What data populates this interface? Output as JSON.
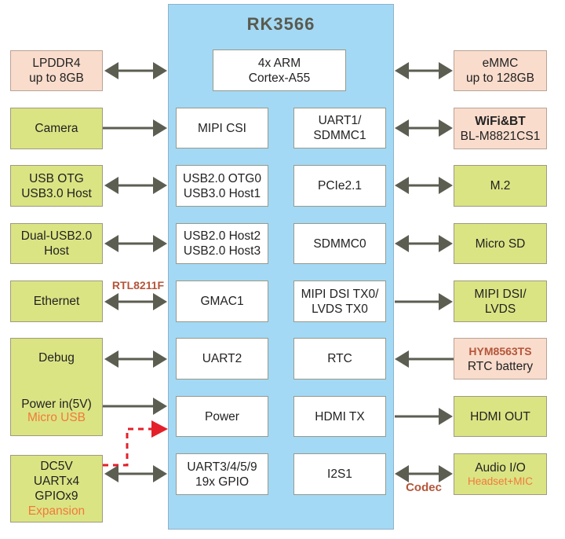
{
  "title": "RK3566",
  "colors": {
    "chip_bg": "#a3d9f5",
    "external_green": "#dbe483",
    "external_peach": "#f9dccc",
    "arrow": "#5b5e50",
    "dashed_power": "#e3202a",
    "accent_orange": "#f07a3c",
    "accent_brown": "#b5553a"
  },
  "cpu": {
    "line1": "4x ARM",
    "line2": "Cortex-A55"
  },
  "internal_blocks": {
    "left": [
      {
        "lines": [
          "MIPI CSI"
        ]
      },
      {
        "lines": [
          "USB2.0 OTG0",
          "USB3.0 Host1"
        ]
      },
      {
        "lines": [
          "USB2.0 Host2",
          "USB2.0 Host3"
        ]
      },
      {
        "lines": [
          "GMAC1"
        ]
      },
      {
        "lines": [
          "UART2"
        ]
      },
      {
        "lines": [
          "Power"
        ]
      },
      {
        "lines": [
          "UART3/4/5/9",
          "19x GPIO"
        ]
      }
    ],
    "right": [
      {
        "lines": [
          "UART1/",
          "SDMMC1"
        ]
      },
      {
        "lines": [
          "PCIe2.1"
        ]
      },
      {
        "lines": [
          "SDMMC0"
        ]
      },
      {
        "lines": [
          "MIPI DSI TX0/",
          "LVDS TX0"
        ]
      },
      {
        "lines": [
          "RTC"
        ]
      },
      {
        "lines": [
          "HDMI TX"
        ]
      },
      {
        "lines": [
          "I2S1"
        ]
      }
    ]
  },
  "external_left": [
    {
      "lines": [
        "LPDDR4",
        "up to 8GB"
      ],
      "connection": "bidirectional"
    },
    {
      "lines": [
        "Camera"
      ],
      "connection": "to-chip"
    },
    {
      "lines": [
        "USB OTG",
        "USB3.0 Host"
      ],
      "connection": "bidirectional"
    },
    {
      "lines": [
        "Dual-USB2.0",
        "Host"
      ],
      "connection": "bidirectional"
    },
    {
      "lines": [
        "Ethernet"
      ],
      "connection": "bidirectional",
      "link_label": "RTL8211F"
    },
    {
      "lines": [
        "Debug",
        "Power in(5V)"
      ],
      "sub": "Micro USB",
      "connection": "bidirectional + to-chip"
    },
    {
      "lines": [
        "DC5V",
        "UARTx4",
        "GPIOx9"
      ],
      "sub": "Expansion",
      "connection": "bidirectional + dashed power"
    }
  ],
  "external_right": [
    {
      "lines": [
        "eMMC",
        "up to 128GB"
      ],
      "connection": "bidirectional"
    },
    {
      "title": "WiFi&BT",
      "lines": [
        "BL-M8821CS1"
      ],
      "connection": "bidirectional"
    },
    {
      "lines": [
        "M.2"
      ],
      "connection": "bidirectional"
    },
    {
      "lines": [
        "Micro SD"
      ],
      "connection": "bidirectional"
    },
    {
      "lines": [
        "MIPI DSI/",
        "LVDS"
      ],
      "connection": "from-chip"
    },
    {
      "title": "HYM8563TS",
      "lines": [
        "RTC battery"
      ],
      "connection": "to-chip"
    },
    {
      "lines": [
        "HDMI OUT"
      ],
      "connection": "from-chip"
    },
    {
      "lines": [
        "Audio I/O"
      ],
      "sub": "Headset+MIC",
      "connection": "bidirectional",
      "link_label": "Codec"
    }
  ]
}
